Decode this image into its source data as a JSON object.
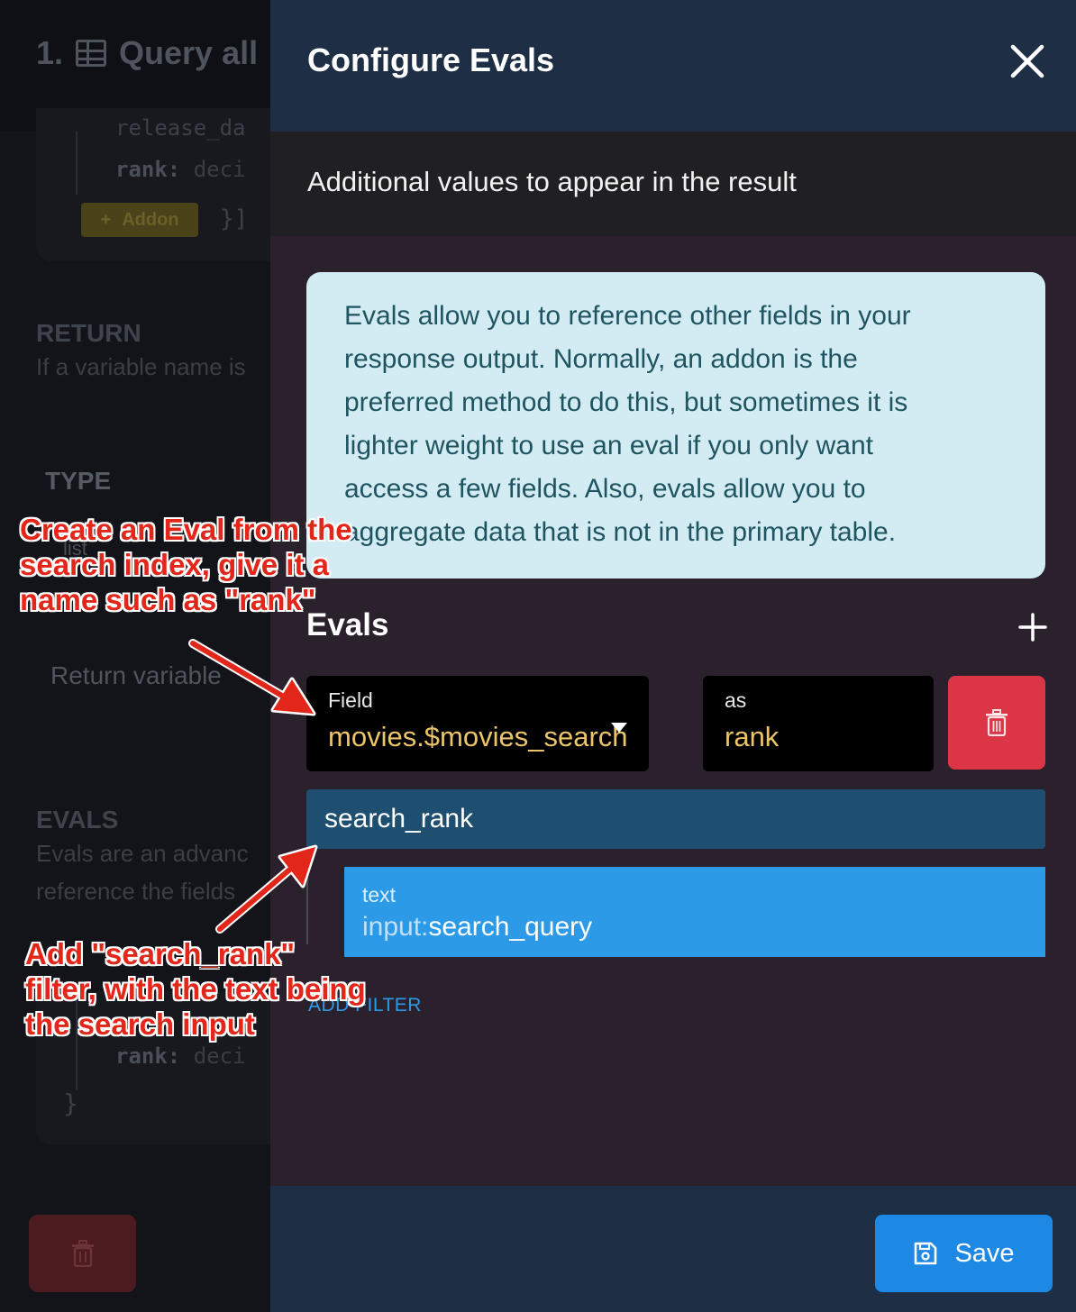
{
  "background_page": {
    "step_title": "1.",
    "step_name": "Query all",
    "code_top_fragment": "release_da",
    "code_rank_key": "rank:",
    "code_rank_type": "deci",
    "addon_button": "Addon",
    "brackets": "}]",
    "return_label": "RETURN",
    "return_desc": "If a variable name is",
    "type_label": "TYPE",
    "list_text": "list",
    "return_variable": "Return variable",
    "evals_label": "EVALS",
    "evals_desc_1": "Evals are an advanc",
    "evals_desc_2": "reference the fields",
    "code2_rank_key": "rank:",
    "code2_rank_type": "deci",
    "closing_brace": "}"
  },
  "drawer": {
    "title": "Configure Evals",
    "subheader": "Additional values to appear in the result",
    "info_lines": [
      "Evals allow you to reference other fields in your",
      "response output. Normally, an addon is the",
      "preferred method to do this, but sometimes it is",
      "lighter weight to use an eval if you only want",
      "access a few fields. Also, evals allow you to",
      "aggregate data that is not in the primary table."
    ],
    "evals_heading": "Evals",
    "eval": {
      "field_label": "Field",
      "field_value": "movies.$movies_search",
      "as_label": "as",
      "as_value": "rank",
      "filter_name": "search_rank",
      "arg_label": "text",
      "arg_prefix": "input:",
      "arg_value": "search_query"
    },
    "add_filter": "ADD FILTER",
    "save_button": "Save"
  },
  "annotations": {
    "top": [
      "Create an Eval from the",
      "search index, give it a",
      "name such as \"rank\""
    ],
    "bottom": [
      "Add \"search_rank\"",
      "filter, with the text being",
      "the search input"
    ]
  },
  "colors": {
    "drawer_bg": "#2a212d",
    "header_bg": "#1e2f45",
    "info_bg": "#d3ebf3",
    "field_value": "#ecc46a",
    "delete": "#dc3545",
    "filter": "#1f4f70",
    "argument": "#2d9ae8",
    "save": "#1e88e5",
    "annotation": "#e3261a"
  }
}
